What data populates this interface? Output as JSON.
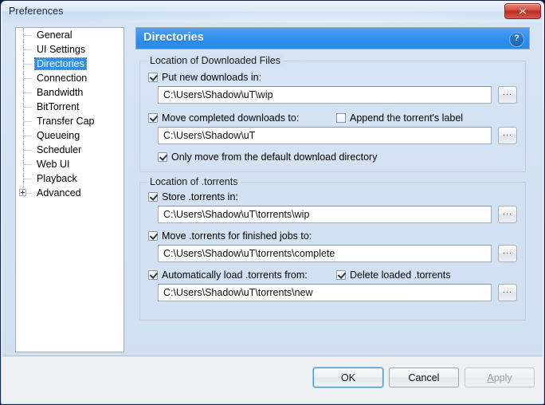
{
  "window": {
    "title": "Preferences",
    "close_icon": "close-icon",
    "accent_color": "#2f8fee",
    "close_button_color": "#bd2f22"
  },
  "sidebar": {
    "items": [
      {
        "label": "General",
        "selected": false,
        "expandable": false
      },
      {
        "label": "UI Settings",
        "selected": false,
        "expandable": false
      },
      {
        "label": "Directories",
        "selected": true,
        "expandable": false
      },
      {
        "label": "Connection",
        "selected": false,
        "expandable": false
      },
      {
        "label": "Bandwidth",
        "selected": false,
        "expandable": false
      },
      {
        "label": "BitTorrent",
        "selected": false,
        "expandable": false
      },
      {
        "label": "Transfer Cap",
        "selected": false,
        "expandable": false
      },
      {
        "label": "Queueing",
        "selected": false,
        "expandable": false
      },
      {
        "label": "Scheduler",
        "selected": false,
        "expandable": false
      },
      {
        "label": "Web UI",
        "selected": false,
        "expandable": false
      },
      {
        "label": "Playback",
        "selected": false,
        "expandable": false
      },
      {
        "label": "Advanced",
        "selected": false,
        "expandable": true
      }
    ]
  },
  "page": {
    "title": "Directories",
    "help_icon": "?",
    "help_icon_name": "help-icon"
  },
  "groups": {
    "downloads": {
      "title": "Location of Downloaded Files",
      "put_new_downloads": {
        "label": "Put new downloads in:",
        "checked": true,
        "path": "C:\\Users\\Shadow\\uT\\wip",
        "browse_label": "..."
      },
      "move_completed": {
        "label": "Move completed downloads to:",
        "checked": true,
        "path": "C:\\Users\\Shadow\\uT",
        "browse_label": "..."
      },
      "append_label": {
        "label": "Append the torrent's label",
        "checked": false
      },
      "only_move_default": {
        "label": "Only move from the default download directory",
        "checked": true
      }
    },
    "torrents": {
      "title": "Location of .torrents",
      "store_torrents": {
        "label": "Store .torrents in:",
        "checked": true,
        "path": "C:\\Users\\Shadow\\uT\\torrents\\wip",
        "browse_label": "..."
      },
      "move_finished": {
        "label": "Move .torrents for finished jobs to:",
        "checked": true,
        "path": "C:\\Users\\Shadow\\uT\\torrents\\complete",
        "browse_label": "..."
      },
      "auto_load": {
        "label": "Automatically load .torrents from:",
        "checked": true,
        "path": "C:\\Users\\Shadow\\uT\\torrents\\new",
        "browse_label": "..."
      },
      "delete_loaded": {
        "label": "Delete loaded .torrents",
        "checked": true
      }
    }
  },
  "footer": {
    "ok": "OK",
    "cancel": "Cancel",
    "apply": "Apply",
    "apply_enabled": false
  }
}
